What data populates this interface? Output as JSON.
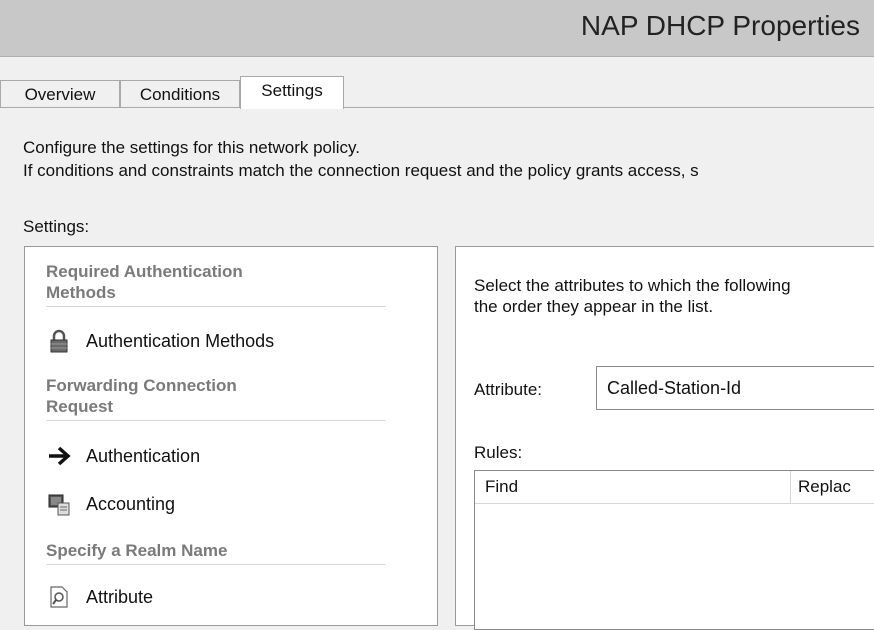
{
  "window": {
    "title": "NAP DHCP Properties"
  },
  "tabs": [
    {
      "label": "Overview"
    },
    {
      "label": "Conditions"
    },
    {
      "label": "Settings"
    }
  ],
  "description": {
    "line1": "Configure the settings for this network policy.",
    "line2": "If conditions and constraints match the connection request and the policy grants access, s"
  },
  "settings_label": "Settings:",
  "sidebar": {
    "sections": [
      {
        "title_line1": "Required Authentication",
        "title_line2": "Methods"
      },
      {
        "title_line1": "Forwarding Connection",
        "title_line2": "Request"
      },
      {
        "title_line1": "Specify a Realm Name"
      }
    ],
    "items": [
      {
        "label": "Authentication Methods",
        "icon": "lock-icon"
      },
      {
        "label": "Authentication",
        "icon": "arrow-right-icon"
      },
      {
        "label": "Accounting",
        "icon": "accounting-icon"
      },
      {
        "label": "Attribute",
        "icon": "attribute-icon"
      }
    ]
  },
  "detail": {
    "text_line1": "Select the attributes to which the following",
    "text_line2": "the order they appear in the list.",
    "attribute_label": "Attribute:",
    "attribute_value": "Called-Station-Id",
    "rules_label": "Rules:",
    "columns": [
      "Find",
      "Replac"
    ]
  }
}
